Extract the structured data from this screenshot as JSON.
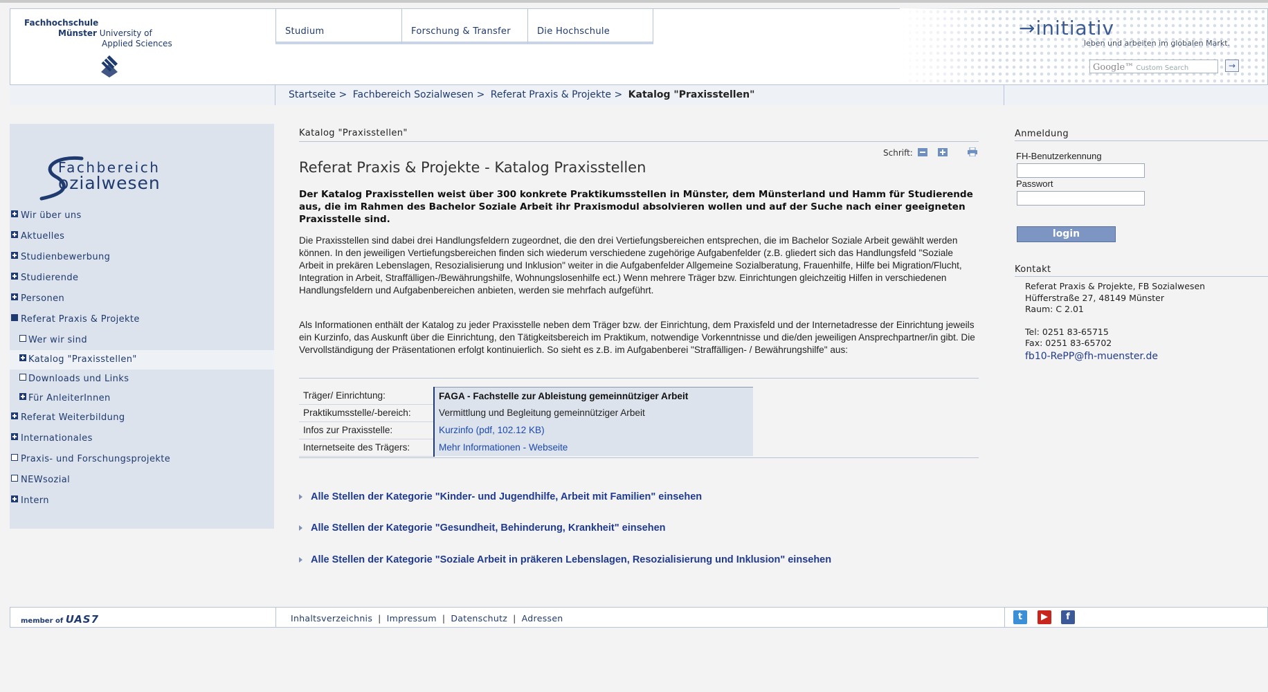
{
  "header": {
    "logo": {
      "line1": "Fachhochschule",
      "line2_bold": "Münster",
      "line2_rest": "University of",
      "line3": "Applied Sciences"
    },
    "nav": [
      "Studium",
      "Forschung & Transfer",
      "Die Hochschule"
    ],
    "initiativ_title": "initiativ",
    "initiativ_sub": "leben und arbeiten im globalen Markt.",
    "search_logo": "Google™",
    "search_placeholder": "Custom Search",
    "search_button": "→"
  },
  "breadcrumb": {
    "items": [
      "Startseite >",
      "Fachbereich Sozialwesen >",
      "Referat Praxis & Projekte >"
    ],
    "current": "Katalog \"Praxisstellen\""
  },
  "sidebar": {
    "logo_line1": "Fachbereich",
    "logo_line2": "ozialwesen",
    "items": [
      {
        "label": "Wir über uns",
        "marker": "plus",
        "level": 0
      },
      {
        "label": "Aktuelles",
        "marker": "plus",
        "level": 0
      },
      {
        "label": "Studienbewerbung",
        "marker": "plus",
        "level": 0
      },
      {
        "label": "Studierende",
        "marker": "plus",
        "level": 0
      },
      {
        "label": "Personen",
        "marker": "plus",
        "level": 0
      },
      {
        "label": "Referat Praxis & Projekte",
        "marker": "filled",
        "level": 0
      },
      {
        "label": "Wer wir sind",
        "marker": "empty",
        "level": 1
      },
      {
        "label": "Katalog \"Praxisstellen\"",
        "marker": "plus",
        "level": 1,
        "active": true
      },
      {
        "label": "Downloads und Links",
        "marker": "empty",
        "level": 1
      },
      {
        "label": "Für AnleiterInnen",
        "marker": "plus",
        "level": 1
      },
      {
        "label": "Referat Weiterbildung",
        "marker": "plus",
        "level": 0
      },
      {
        "label": "Internationales",
        "marker": "plus",
        "level": 0
      },
      {
        "label": "Praxis- und Forschungsprojekte",
        "marker": "empty",
        "level": 0
      },
      {
        "label": "NEWsozial",
        "marker": "empty",
        "level": 0
      },
      {
        "label": "Intern",
        "marker": "plus",
        "level": 0
      }
    ]
  },
  "main": {
    "page_crumb": "Katalog \"Praxisstellen\"",
    "font_label": "Schrift:",
    "title": "Referat Praxis & Projekte - Katalog Praxisstellen",
    "intro": "Der Katalog Praxisstellen weist über 300 konkrete Praktikumsstellen in Münster, dem Münsterland und Hamm für Studierende aus, die im Rahmen des Bachelor Soziale Arbeit ihr Praxismodul absolvieren wollen und auf der Suche nach einer geeigneten Praxisstelle sind.",
    "paragraph1": "Die Praxisstellen sind dabei drei Handlungsfeldern zugeordnet, die den drei Vertiefungsbereichen entsprechen, die im Bachelor Soziale Arbeit gewählt werden können. In den jeweiligen Vertiefungsbereichen finden sich wiederum verschiedene zugehörige Aufgabenfelder (z.B. gliedert sich das Handlungsfeld \"Soziale Arbeit in prekären Lebenslagen, Resozialisierung und Inklusion\" weiter in die Aufgabenfelder Allgemeine Sozialberatung, Frauenhilfe, Hilfe bei Migration/Flucht, Integration in Arbeit, Straffälligen-/Bewährungshilfe, Wohnungslosenhilfe ect.) Wenn mehrere Träger bzw. Einrichtungen gleichzeitig Hilfen in verschiedenen Handlungsfeldern und Aufgabenbereichen anbieten, werden sie mehrfach aufgeführt.",
    "paragraph2": "Als Informationen enthält der Katalog zu jeder Praxisstelle neben dem Träger bzw. der Einrichtung, dem Praxisfeld und der Internetadresse der Einrichtung jeweils ein Kurzinfo, das Auskunft über die Einrichtung, den Tätigkeitsbereich im Praktikum, notwendige Vorkenntnisse und die/den jeweiligen Ansprechpartner/in gibt. Die Vervollständigung der Präsentationen erfolgt kontinuierlich. So sieht es z.B. im Aufgabenberei \"Straffälligen- / Bewährungshilfe\" aus:",
    "table": [
      {
        "key": "Träger/ Einrichtung:",
        "value": "FAGA - Fachstelle zur Ableistung gemeinnütziger Arbeit"
      },
      {
        "key": "Praktikumsstelle/-bereich:",
        "value": "Vermittlung und Begleitung gemeinnütziger Arbeit"
      },
      {
        "key": "Infos zur Praxisstelle:",
        "value": "Kurzinfo (pdf, 102.12 KB)",
        "link": true
      },
      {
        "key": "Internetseite des Trägers:",
        "value": "Mehr Informationen - Webseite",
        "link": true
      }
    ],
    "category_links": [
      "Alle Stellen der Kategorie \"Kinder- und Jugendhilfe, Arbeit mit Familien\" einsehen",
      "Alle Stellen der Kategorie \"Gesundheit, Behinderung, Krankheit\" einsehen",
      "Alle Stellen der Kategorie \"Soziale Arbeit in präkeren Lebenslagen, Resozialisierung und Inklusion\" einsehen"
    ]
  },
  "right": {
    "login_heading": "Anmeldung",
    "user_label": "FH-Benutzerkennung",
    "password_label": "Passwort",
    "login_button": "login",
    "contact_heading": "Kontakt",
    "contact_lines": [
      "Referat Praxis & Projekte, FB Sozialwesen",
      "Hüfferstraße 27, 48149 Münster",
      "Raum: C 2.01",
      "",
      "Tel: 0251 83-65715",
      "Fax: 0251 83-65702"
    ],
    "email": "fb10-RePP@fh-muenster.de"
  },
  "footer": {
    "member_of": "member of",
    "uas7": "UAS7",
    "links": [
      "Inhaltsverzeichnis",
      "Impressum",
      "Datenschutz",
      "Adressen"
    ],
    "social_icons": [
      "twitter-icon",
      "youtube-icon",
      "facebook-icon"
    ]
  },
  "colors": {
    "brand": "#1f3a6e",
    "link": "#1a49b0",
    "sidebar_bg": "#dde3ec"
  }
}
